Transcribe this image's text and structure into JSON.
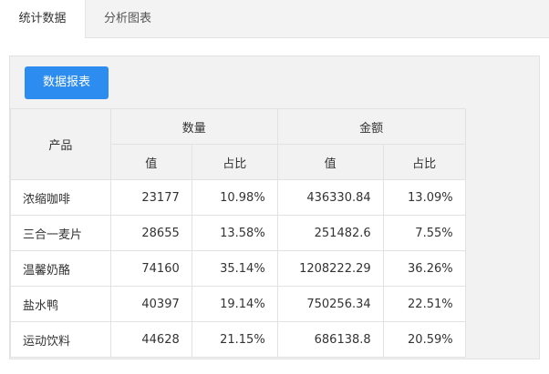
{
  "tabs": [
    {
      "label": "统计数据",
      "active": true
    },
    {
      "label": "分析图表",
      "active": false
    }
  ],
  "toolbar": {
    "report_button": "数据报表"
  },
  "colors": {
    "primary": "#2d8cf0",
    "panel_bg": "#f2f2f2",
    "border": "#e2e2e2"
  },
  "table": {
    "header": {
      "product": "产品",
      "quantity": "数量",
      "amount": "金额",
      "value": "值",
      "share": "占比"
    },
    "rows": [
      {
        "product": "浓缩咖啡",
        "qty": "23177",
        "qty_share": "10.98%",
        "amount": "436330.84",
        "amount_share": "13.09%"
      },
      {
        "product": "三合一麦片",
        "qty": "28655",
        "qty_share": "13.58%",
        "amount": "251482.6",
        "amount_share": "7.55%"
      },
      {
        "product": "温馨奶酪",
        "qty": "74160",
        "qty_share": "35.14%",
        "amount": "1208222.29",
        "amount_share": "36.26%"
      },
      {
        "product": "盐水鸭",
        "qty": "40397",
        "qty_share": "19.14%",
        "amount": "750256.34",
        "amount_share": "22.51%"
      },
      {
        "product": "运动饮料",
        "qty": "44628",
        "qty_share": "21.15%",
        "amount": "686138.8",
        "amount_share": "20.59%"
      }
    ]
  }
}
